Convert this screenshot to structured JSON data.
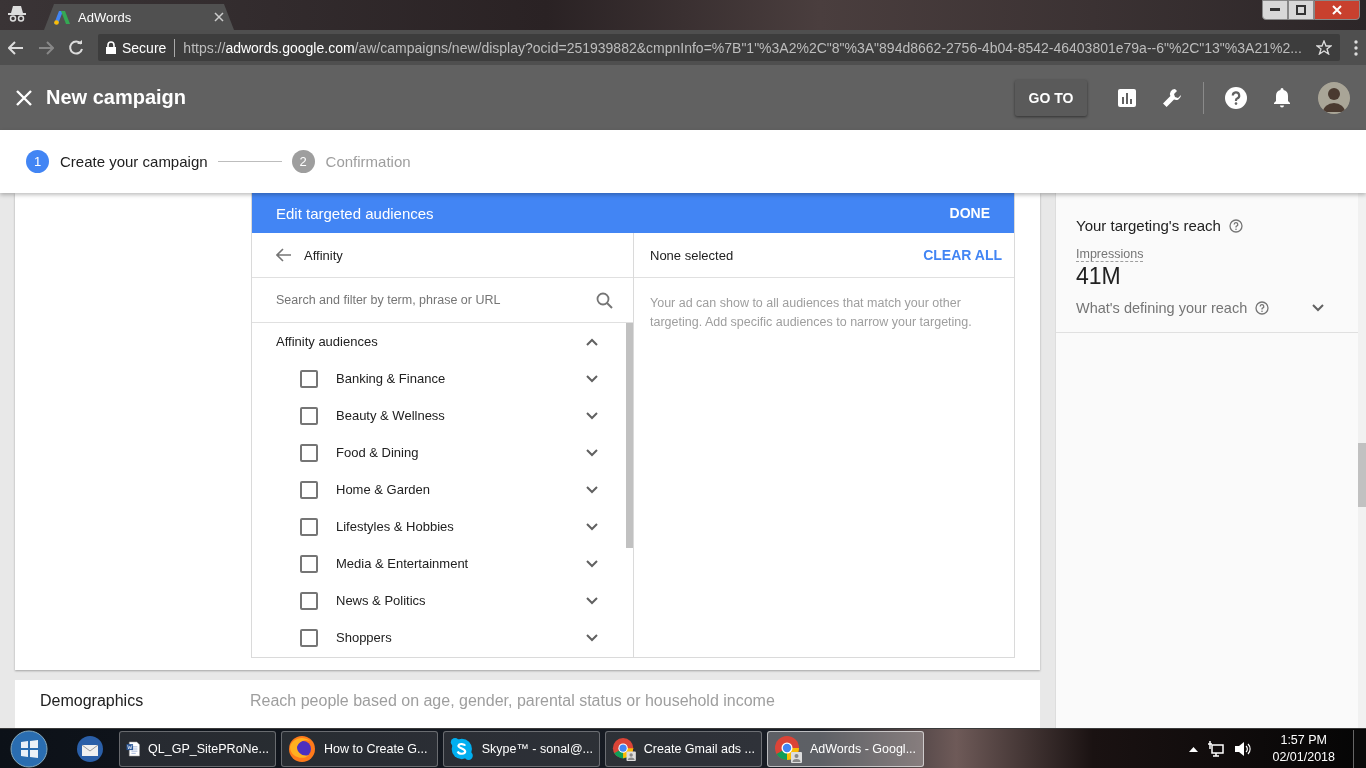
{
  "browser": {
    "tab": {
      "title": "AdWords"
    },
    "address_bar": {
      "security": "Secure",
      "url_scheme": "https://",
      "url_host": "adwords.google.com",
      "url_path": "/aw/campaigns/new/display?ocid=251939882&cmpnInfo=%7B\"1\"%3A2%2C\"8\"%3A\"894d8662-2756-4b04-8542-46403801e79a--6\"%2C\"13\"%3A21%2..."
    }
  },
  "app_bar": {
    "title": "New campaign",
    "goto_button": "GO TO"
  },
  "stepper": [
    {
      "number": "1",
      "label": "Create your campaign",
      "selected": true
    },
    {
      "number": "2",
      "label": "Confirmation",
      "selected": false
    }
  ],
  "audience_editor": {
    "title": "Edit targeted audiences",
    "done_button": "DONE",
    "breadcrumb": "Affinity",
    "search": {
      "placeholder": "Search and filter by term, phrase or URL"
    },
    "group": {
      "label": "Affinity audiences",
      "expanded": true
    },
    "items": [
      {
        "label": "Banking & Finance",
        "checked": false
      },
      {
        "label": "Beauty & Wellness",
        "checked": false
      },
      {
        "label": "Food & Dining",
        "checked": false
      },
      {
        "label": "Home & Garden",
        "checked": false
      },
      {
        "label": "Lifestyles & Hobbies",
        "checked": false
      },
      {
        "label": "Media & Entertainment",
        "checked": false
      },
      {
        "label": "News & Politics",
        "checked": false
      },
      {
        "label": "Shoppers",
        "checked": false
      }
    ],
    "selection_title": "None selected",
    "clear_all_button": "CLEAR ALL",
    "empty_message": "Your ad can show to all audiences that match your other targeting. Add specific audiences to narrow your targeting."
  },
  "next_section": {
    "title": "Demographics",
    "description": "Reach people based on age, gender, parental status or household income"
  },
  "reach_panel": {
    "title": "Your targeting's reach",
    "metric_label": "Impressions",
    "metric_value": "41M",
    "defining_label": "What's defining your reach",
    "expanded": false
  },
  "taskbar": {
    "items": [
      {
        "label": "QL_GP_SitePRoNe...",
        "kind": "word",
        "selected": false
      },
      {
        "label": "How to Create G...",
        "kind": "firefox",
        "selected": false
      },
      {
        "label": "Skype™ - sonal@...",
        "kind": "skype",
        "selected": false
      },
      {
        "label": "Create Gmail ads ...",
        "kind": "chrome",
        "selected": false
      },
      {
        "label": "AdWords - Googl...",
        "kind": "chrome",
        "selected": true
      }
    ],
    "time": "1:57 PM",
    "date": "02/01/2018"
  }
}
